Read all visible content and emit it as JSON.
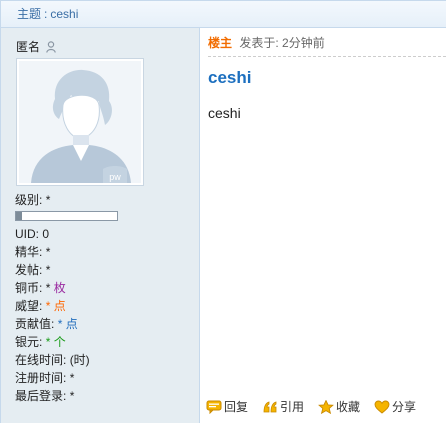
{
  "topic": {
    "prefix": "主题",
    "separator": ":",
    "title": "ceshi"
  },
  "user": {
    "name": "匿名",
    "stats": [
      {
        "label": "级别:",
        "value": "*",
        "unit": "",
        "unit_color": ""
      },
      {
        "label": "UID:",
        "value": "0",
        "unit": "",
        "unit_color": ""
      },
      {
        "label": "精华:",
        "value": "*",
        "unit": "",
        "unit_color": ""
      },
      {
        "label": "发帖:",
        "value": "*",
        "unit": "",
        "unit_color": ""
      },
      {
        "label": "铜币:",
        "value": "*",
        "unit": "枚",
        "unit_color": "purple"
      },
      {
        "label": "威望:",
        "value": "*",
        "unit": "点",
        "unit_color": "orange"
      },
      {
        "label": "贡献值:",
        "value": "*",
        "unit": "点",
        "unit_color": "blue"
      },
      {
        "label": "银元:",
        "value": "*",
        "unit": "个",
        "unit_color": "green"
      },
      {
        "label": "在线时间:",
        "value": "(时)",
        "unit": "",
        "unit_color": ""
      },
      {
        "label": "注册时间:",
        "value": "*",
        "unit": "",
        "unit_color": ""
      },
      {
        "label": "最后登录:",
        "value": "*",
        "unit": "",
        "unit_color": ""
      }
    ],
    "level_progress": 0.06
  },
  "post": {
    "floor_label": "楼主",
    "posted_label": "发表于:",
    "posted_time": "2分钟前",
    "title": "ceshi",
    "body": "ceshi"
  },
  "actions": {
    "reply": "回复",
    "quote": "引用",
    "favorite": "收藏",
    "share": "分享"
  },
  "colors": {
    "sidebar_bg": "#e5edf2",
    "link_blue": "#1c6fbf",
    "floor_orange": "#f26c00",
    "icon_gold": "#f5b400"
  }
}
